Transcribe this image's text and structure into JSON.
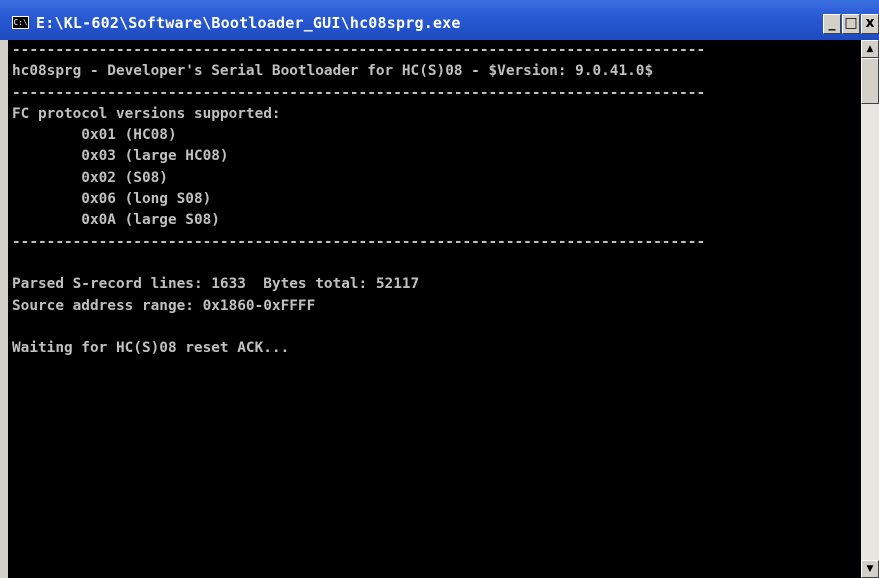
{
  "window": {
    "title": "E:\\KL-602\\Software\\Bootloader_GUI\\hc08sprg.exe",
    "icon_label": "C:\\",
    "minimize_label": "_",
    "maximize_label": "□",
    "close_label": "x"
  },
  "console": {
    "lines": [
      "--------------------------------------------------------------------------------",
      "hc08sprg - Developer's Serial Bootloader for HC(S)08 - $Version: 9.0.41.0$",
      "--------------------------------------------------------------------------------",
      "FC protocol versions supported:",
      "        0x01 (HC08)",
      "        0x03 (large HC08)",
      "        0x02 (S08)",
      "        0x06 (long S08)",
      "        0x0A (large S08)",
      "--------------------------------------------------------------------------------",
      "",
      "Parsed S-record lines: 1633  Bytes total: 52117",
      "Source address range: 0x1860-0xFFFF",
      "",
      "Waiting for HC(S)08 reset ACK..."
    ]
  },
  "scrollbar": {
    "up_arrow": "▲",
    "down_arrow": "▼"
  },
  "colors": {
    "console_bg": "#000000",
    "console_fg": "#c0c0c0",
    "titlebar": "#2a5bd4"
  }
}
